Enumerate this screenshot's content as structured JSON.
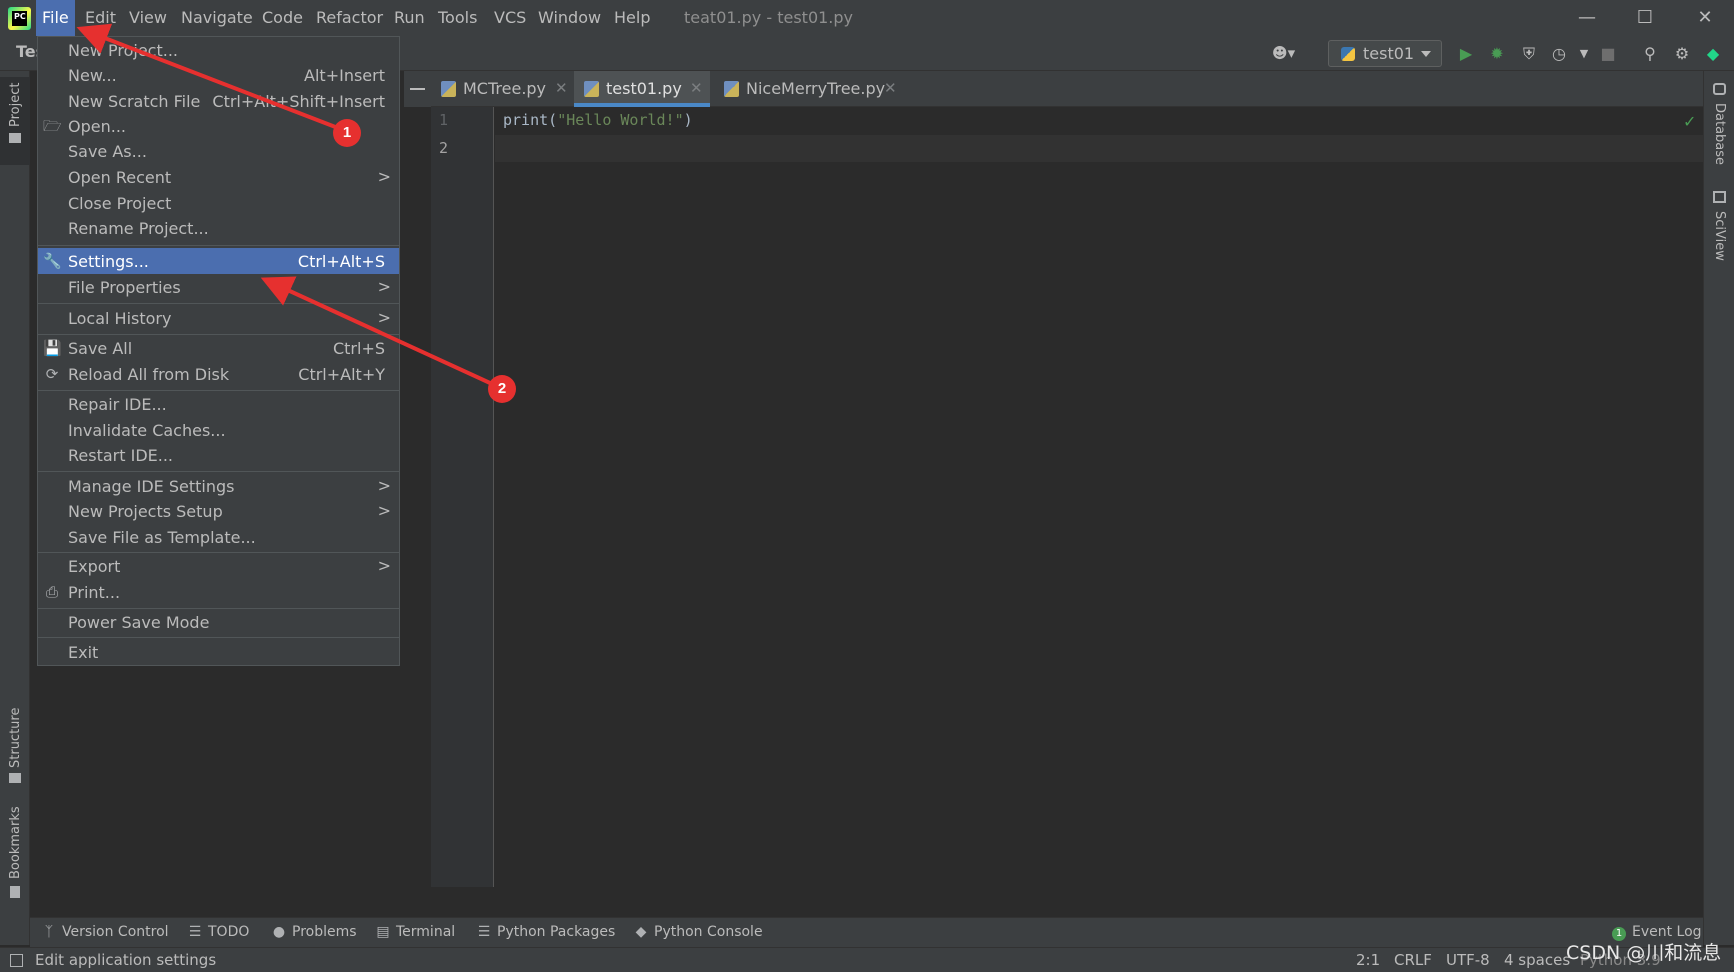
{
  "menubar": {
    "items": [
      "File",
      "Edit",
      "View",
      "Navigate",
      "Code",
      "Refactor",
      "Run",
      "Tools",
      "VCS",
      "Window",
      "Help"
    ],
    "active": "File"
  },
  "window": {
    "title": "teat01.py - test01.py",
    "minimize_glyph": "—",
    "maximize_glyph": "☐",
    "close_glyph": "✕"
  },
  "toolbar": {
    "project_truncated": "Tes",
    "run_config": "test01"
  },
  "left_stripe": {
    "project": "Project",
    "structure": "Structure",
    "bookmarks": "Bookmarks"
  },
  "right_stripe": {
    "database": "Database",
    "sciview": "SciView"
  },
  "editor": {
    "tabs": [
      {
        "label": "MCTree.py",
        "active": false
      },
      {
        "label": "test01.py",
        "active": true
      },
      {
        "label": "NiceMerryTree.py",
        "active": false
      }
    ],
    "close_glyph": "✕",
    "line_numbers": [
      "1",
      "2"
    ],
    "code": {
      "fn": "print(",
      "str": "\"Hello World!\"",
      "end": ")"
    }
  },
  "file_menu": {
    "items": [
      {
        "label": "New Project...",
        "shortcut": "",
        "submenu": false
      },
      {
        "label": "New...",
        "shortcut": "Alt+Insert",
        "submenu": false
      },
      {
        "label": "New Scratch File",
        "shortcut": "Ctrl+Alt+Shift+Insert",
        "submenu": false
      },
      {
        "label": "Open...",
        "shortcut": "",
        "submenu": false,
        "icon": "folder-icon"
      },
      {
        "label": "Save As...",
        "shortcut": "",
        "submenu": false
      },
      {
        "label": "Open Recent",
        "shortcut": "",
        "submenu": true
      },
      {
        "label": "Close Project",
        "shortcut": "",
        "submenu": false
      },
      {
        "label": "Rename Project...",
        "shortcut": "",
        "submenu": false
      },
      {
        "label": "Settings...",
        "shortcut": "Ctrl+Alt+S",
        "submenu": false,
        "icon": "wrench-icon",
        "selected": true
      },
      {
        "label": "File Properties",
        "shortcut": "",
        "submenu": true
      },
      {
        "label": "Local History",
        "shortcut": "",
        "submenu": true
      },
      {
        "label": "Save All",
        "shortcut": "Ctrl+S",
        "submenu": false,
        "icon": "save-icon"
      },
      {
        "label": "Reload All from Disk",
        "shortcut": "Ctrl+Alt+Y",
        "submenu": false,
        "icon": "reload-icon"
      },
      {
        "label": "Repair IDE...",
        "shortcut": "",
        "submenu": false
      },
      {
        "label": "Invalidate Caches...",
        "shortcut": "",
        "submenu": false
      },
      {
        "label": "Restart IDE...",
        "shortcut": "",
        "submenu": false
      },
      {
        "label": "Manage IDE Settings",
        "shortcut": "",
        "submenu": true
      },
      {
        "label": "New Projects Setup",
        "shortcut": "",
        "submenu": true
      },
      {
        "label": "Save File as Template...",
        "shortcut": "",
        "submenu": false
      },
      {
        "label": "Export",
        "shortcut": "",
        "submenu": true
      },
      {
        "label": "Print...",
        "shortcut": "",
        "submenu": false,
        "icon": "printer-icon"
      },
      {
        "label": "Power Save Mode",
        "shortcut": "",
        "submenu": false
      },
      {
        "label": "Exit",
        "shortcut": "",
        "submenu": false
      }
    ],
    "submenu_arrow": ">"
  },
  "bottom_tools": {
    "items": [
      "Version Control",
      "TODO",
      "Problems",
      "Terminal",
      "Python Packages",
      "Python Console"
    ],
    "event_log": "Event Log",
    "event_count": "1"
  },
  "status": {
    "message": "Edit application settings",
    "position": "2:1",
    "line_sep": "CRLF",
    "encoding": "UTF-8",
    "indent": "4 spaces",
    "interpreter": "Python 3.9"
  },
  "watermark": "CSDN @川和流息",
  "annotations": {
    "badge1": "1",
    "badge2": "2",
    "arrow_color": "#e6302f"
  },
  "colors": {
    "accent": "#4b6eaf",
    "run_green": "#499c54",
    "string_green": "#6a8759",
    "annotation_red": "#e6302f"
  }
}
